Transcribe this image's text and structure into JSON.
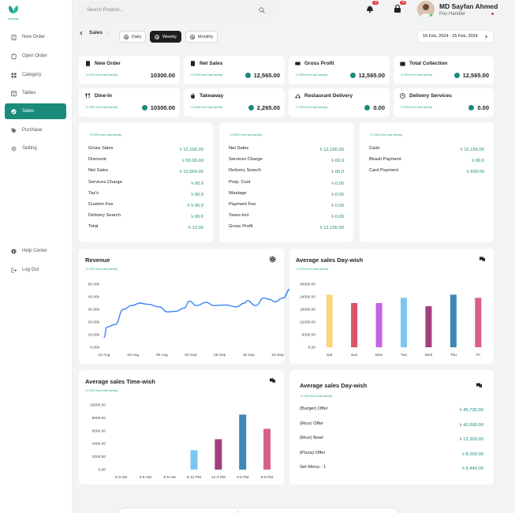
{
  "brand": {
    "name": "Ganvay",
    "color": "#1b9e8a"
  },
  "sidebar": {
    "items": [
      {
        "label": "New Order",
        "icon": "receipt-icon"
      },
      {
        "label": "Open Order",
        "icon": "clipboard-icon"
      },
      {
        "label": "Category",
        "icon": "grid-icon"
      },
      {
        "label": "Tables",
        "icon": "table-icon"
      },
      {
        "label": "Sales",
        "icon": "sales-icon",
        "active": true
      },
      {
        "label": "Purchase",
        "icon": "tag-icon"
      },
      {
        "label": "Setting",
        "icon": "gear-icon"
      }
    ],
    "bottom": [
      {
        "label": "Help Center",
        "icon": "info-icon"
      },
      {
        "label": "Log Out",
        "icon": "logout-icon"
      }
    ]
  },
  "header": {
    "search_placeholder": "Search Product...",
    "notifications_badge": "10",
    "cart_badge": "18",
    "user_name": "MD Sayfan Ahmed",
    "user_role": "Pos Handler"
  },
  "toolbar": {
    "breadcrumb": "Sales",
    "tabs": [
      "Daily",
      "Weekly",
      "Monthly"
    ],
    "active_tab": "Weekly",
    "date_range": "18 Feb, 2024 - 25 Feb, 2024"
  },
  "kpis": [
    {
      "label": "New Order",
      "delta": "+3.62% from last weekly",
      "value": "10300.00",
      "coin": false
    },
    {
      "label": "Net Sales",
      "delta": "+2.25% from last weekly",
      "value": "12,565.00",
      "coin": true
    },
    {
      "label": "Gross Profit",
      "delta": "+2.25% from last weekly",
      "value": "12,565.00",
      "coin": true
    },
    {
      "label": "Total Collection",
      "delta": "+2.25% from last weekly",
      "value": "12,565.00",
      "coin": true
    },
    {
      "label": "Dine-In",
      "delta": "+2.25% from last weekly",
      "value": "10300.00",
      "coin": true
    },
    {
      "label": "Takeaway",
      "delta": "+2.25% from last weekly",
      "value": "2,265.00",
      "coin": true
    },
    {
      "label": "Restaurant Delivery",
      "delta": "+2.25% from last weekly",
      "value": "0.00",
      "coin": true
    },
    {
      "label": "Delivery Services",
      "delta": "+2.25% from last weekly",
      "value": "0.00",
      "coin": true
    }
  ],
  "summary": {
    "delta": "+2.25% from last weekly",
    "col1": [
      {
        "k": "Gross Sales",
        "v": "৳ 12,156.00"
      },
      {
        "k": "Discount",
        "v": "৳ 50.00.00"
      },
      {
        "k": "Net Sales",
        "v": "৳ 12,564.00"
      },
      {
        "k": "Services Charge",
        "v": "৳ 00.0"
      },
      {
        "k": "Tax's",
        "v": "৳ 00.0"
      },
      {
        "k": "Custom Fee",
        "v": "৳ ৳ 00.0"
      },
      {
        "k": "Delivery Search",
        "v": "৳ 00.0"
      },
      {
        "k": "Total",
        "v": "৳ 12.00"
      }
    ],
    "col2": [
      {
        "k": "Net Sales",
        "v": "৳ 12,156.00"
      },
      {
        "k": "Services Charge",
        "v": "৳ 00.0"
      },
      {
        "k": "Delivery Search",
        "v": "৳ 00.0"
      },
      {
        "k": "Prep. Cost",
        "v": "৳ 0.00"
      },
      {
        "k": "Wastage",
        "v": "৳ 0.00"
      },
      {
        "k": "Payment Fee",
        "v": "৳ 0.00"
      },
      {
        "k": "Taxes incl.",
        "v": "৳ 0.00"
      },
      {
        "k": "Gross Profit",
        "v": "৳ 12,156.00"
      }
    ],
    "col3": [
      {
        "k": "Cash",
        "v": "৳ 12,156.00"
      },
      {
        "k": "Bkash Payment",
        "v": "৳ 00.0"
      },
      {
        "k": "Card Payment",
        "v": "৳ 500.00"
      }
    ]
  },
  "revenue": {
    "title": "Revenue",
    "delta": "+2.25% from last weekly",
    "icon": "gear-icon"
  },
  "day_wish": {
    "title": "Average sales Day-wish",
    "delta": "+2.25% from last weekly",
    "icon": "chat-icon"
  },
  "time_wish": {
    "title": "Average sales Time-wish",
    "delta": "+2.25% from last weekly",
    "icon": "chat-icon"
  },
  "offers": {
    "title": "Average sales Day-wish",
    "delta": "+2.25% from last weekly",
    "icon": "chat-icon",
    "items": [
      {
        "k": "(Burger) Offer",
        "v": "৳ 45,730.00"
      },
      {
        "k": "(Rice) Offer",
        "v": "৳ 42,000.00"
      },
      {
        "k": "(Rice) Bowl",
        "v": "৳ 12,300.00"
      },
      {
        "k": "(Pizza) Offer",
        "v": "৳ 8,200.00"
      },
      {
        "k": "Set Menu - 1",
        "v": "৳ 5,440.00"
      }
    ]
  },
  "chart_data": [
    {
      "type": "line",
      "x": [
        "12 Aug",
        "19 Aug",
        "26 Aug",
        "02 Sep",
        "09 Sep",
        "16 Sep",
        "23 Sep"
      ],
      "ylim": [
        0,
        50000
      ],
      "yticks": [
        "50.00k",
        "40.00k",
        "30.00k",
        "20.00k",
        "10.00k",
        "0.00k"
      ],
      "points": [
        [
          0,
          8000
        ],
        [
          0.1,
          16000
        ],
        [
          0.4,
          18000
        ],
        [
          0.7,
          30000
        ],
        [
          1,
          33000
        ],
        [
          1.3,
          35000
        ],
        [
          1.6,
          34000
        ],
        [
          2,
          32000
        ],
        [
          2.3,
          28000
        ],
        [
          2.6,
          28500
        ],
        [
          2.9,
          31000
        ],
        [
          3.1,
          36500
        ],
        [
          3.35,
          33000
        ],
        [
          3.7,
          35500
        ],
        [
          4,
          33000
        ],
        [
          4.4,
          33500
        ],
        [
          4.8,
          32000
        ],
        [
          5.1,
          35000
        ],
        [
          5.2,
          37000
        ],
        [
          5.5,
          33000
        ],
        [
          5.8,
          39000
        ],
        [
          6,
          38000
        ],
        [
          6.2,
          36000
        ],
        [
          6.5,
          39000
        ],
        [
          6.75,
          46000
        ],
        [
          7.3,
          48500
        ]
      ],
      "color": "#3b82f6"
    },
    {
      "type": "bar",
      "categories": [
        "Sat",
        "Sun",
        "Mon",
        "Tue",
        "Wed",
        "Thu",
        "Fri"
      ],
      "values": [
        25000,
        21000,
        21000,
        23500,
        19500,
        25000,
        23500
      ],
      "colors": [
        "#f7d77a",
        "#d9546b",
        "#c564e3",
        "#7cc7f2",
        "#a2407e",
        "#3f87b8",
        "#d95f87"
      ],
      "ylim": [
        0,
        30000
      ],
      "yticks": [
        "30000.00",
        "24000.00",
        "18000.00",
        "12000.00",
        "6000.00",
        "0.00"
      ]
    },
    {
      "type": "bar",
      "categories": [
        "0-3 AM",
        "3-6 AM",
        "6-9 AM",
        "9-12 PM",
        "12-3 PM",
        "3-6 PM",
        "6-9 PM"
      ],
      "values": [
        0,
        0,
        0,
        3000,
        4700,
        8500,
        6300
      ],
      "colors": [
        "#7cc7f2",
        "#7cc7f2",
        "#7cc7f2",
        "#7cc7f2",
        "#a2407e",
        "#3f87b8",
        "#d95f87"
      ],
      "ylim": [
        0,
        10000
      ],
      "yticks": [
        "10000.00",
        "8000.00",
        "6000.00",
        "4000.00",
        "2000.00",
        "0.00"
      ]
    }
  ]
}
